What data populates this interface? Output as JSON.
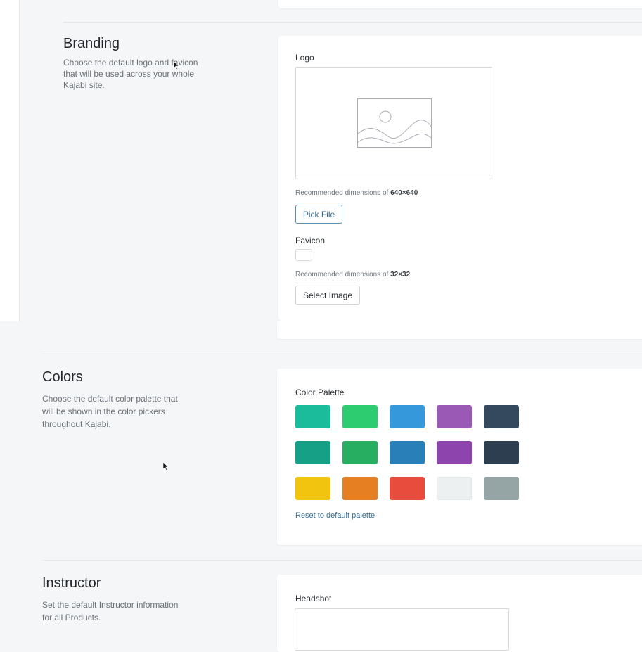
{
  "branding": {
    "title": "Branding",
    "description_lines": [
      "Choose the default logo and favicon",
      "that will be used across your whole",
      "Kajabi site."
    ],
    "logo_label": "Logo",
    "logo_hint_prefix": "Recommended dimensions of ",
    "logo_hint_value": "640×640",
    "pick_file_label": "Pick File",
    "favicon_label": "Favicon",
    "favicon_hint_prefix": "Recommended dimensions of ",
    "favicon_hint_value": "32×32",
    "select_image_label": "Select Image"
  },
  "colors": {
    "title": "Colors",
    "description_lines": [
      "Choose the default color palette that",
      "will be shown in the color pickers",
      "throughout Kajabi."
    ],
    "palette_label": "Color Palette",
    "swatches": [
      [
        "#1abc9c",
        "#2ecc71",
        "#3498db",
        "#9b59b6",
        "#34495e"
      ],
      [
        "#16a085",
        "#27ae60",
        "#2980b9",
        "#8e44ad",
        "#2c3e50"
      ],
      [
        "#f1c40f",
        "#e67e22",
        "#e74c3c",
        "#ecf0f1",
        "#95a5a6"
      ]
    ],
    "reset_label": "Reset to default palette"
  },
  "instructor": {
    "title": "Instructor",
    "description_lines": [
      "Set the default Instructor information",
      "for all Products."
    ],
    "headshot_label": "Headshot"
  }
}
